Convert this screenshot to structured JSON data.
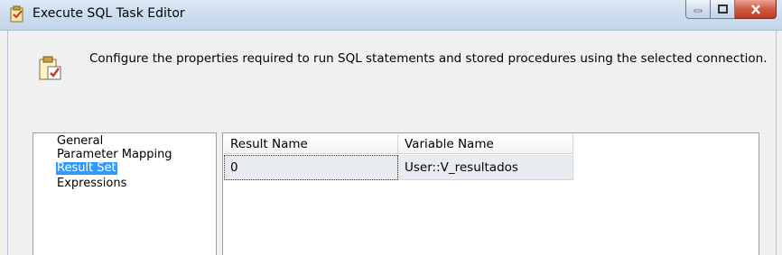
{
  "window": {
    "title": "Execute SQL Task Editor"
  },
  "header": {
    "description": "Configure the properties required to run SQL statements and stored procedures using the selected connection."
  },
  "nav": {
    "items": [
      {
        "label": "General"
      },
      {
        "label": "Parameter Mapping"
      },
      {
        "label": "Result Set"
      },
      {
        "label": "Expressions"
      }
    ],
    "selected": "Result Set"
  },
  "result_grid": {
    "columns": [
      "Result Name",
      "Variable Name"
    ],
    "rows": [
      [
        "0",
        "User::V_resultados"
      ]
    ]
  },
  "icons": [
    "task-editor-icon",
    "minimize-icon",
    "maximize-icon",
    "close-icon",
    "sql-task-icon"
  ]
}
